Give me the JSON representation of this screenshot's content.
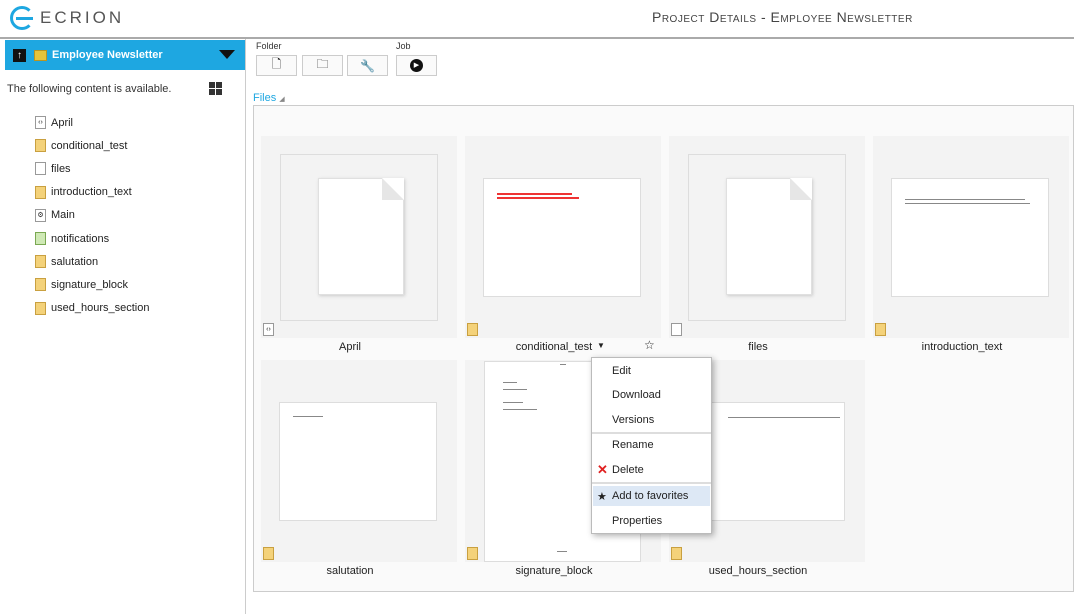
{
  "brand": "ECRION",
  "page_title": "Project Details - Employee Newsletter",
  "sidebar": {
    "project": "Employee Newsletter",
    "intro": "The following content is available.",
    "items": [
      {
        "label": "April",
        "icon": "template-icon"
      },
      {
        "label": "conditional_test",
        "icon": "document-icon"
      },
      {
        "label": "files",
        "icon": "blank-file-icon"
      },
      {
        "label": "introduction_text",
        "icon": "document-icon"
      },
      {
        "label": "Main",
        "icon": "main-file-icon"
      },
      {
        "label": "notifications",
        "icon": "notification-file-icon"
      },
      {
        "label": "salutation",
        "icon": "document-icon"
      },
      {
        "label": "signature_block",
        "icon": "document-icon"
      },
      {
        "label": "used_hours_section",
        "icon": "document-icon"
      }
    ]
  },
  "toolbar": {
    "folder_label": "Folder",
    "job_label": "Job"
  },
  "files_label": "Files",
  "tiles": [
    {
      "name": "April"
    },
    {
      "name": "conditional_test"
    },
    {
      "name": "files"
    },
    {
      "name": "introduction_text"
    },
    {
      "name": "salutation"
    },
    {
      "name": "signature_block"
    },
    {
      "name": "used_hours_section"
    }
  ],
  "context_menu": {
    "items": [
      "Edit",
      "Download",
      "Versions",
      "Rename",
      "Delete",
      "Add to favorites",
      "Properties"
    ],
    "highlighted": "Add to favorites"
  },
  "colors": {
    "accent": "#1ea7e1",
    "delete": "#e02020"
  }
}
